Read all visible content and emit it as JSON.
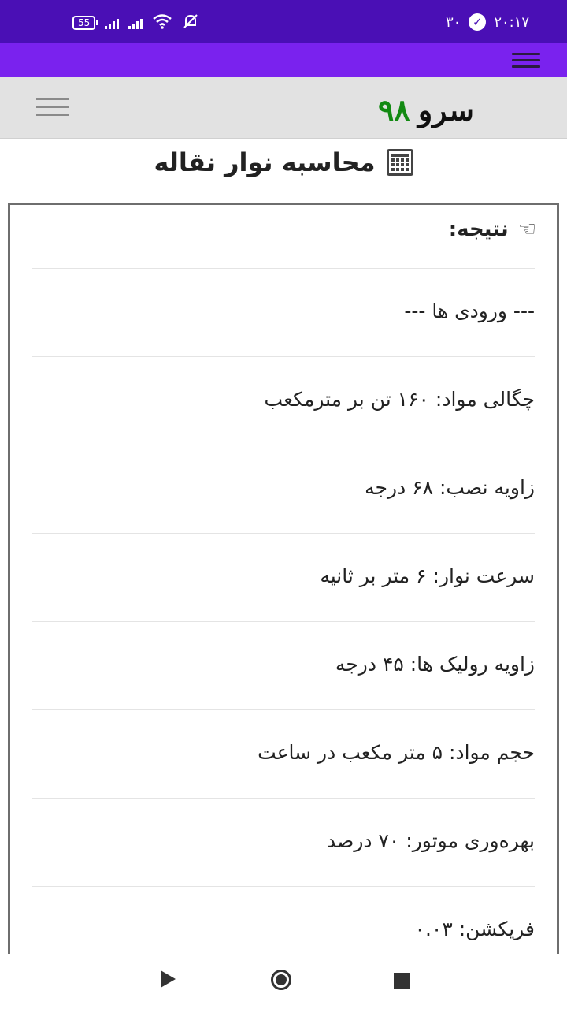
{
  "status_bar": {
    "time": "۲۰:۱۷",
    "notification_count": "۳۰",
    "battery": "55",
    "colors": {
      "background": "#4a0fb5"
    }
  },
  "app_bar": {
    "color": "#7a22ee",
    "menu_icon": "hamburger-icon"
  },
  "site_header": {
    "logo_word": "سرو",
    "logo_number": "۹۸",
    "menu_icon": "hamburger-icon"
  },
  "page": {
    "title": "محاسبه نوار نقاله",
    "title_icon": "calculator-icon"
  },
  "result": {
    "title": "نتیجه:",
    "title_icon": "hand-pointing-icon",
    "rows": [
      "--- ورودی ها ---",
      "چگالی مواد: ۱۶۰ تن بر مترمکعب",
      "زاویه نصب: ۶۸ درجه",
      "سرعت نوار: ۶ متر بر ثانیه",
      "زاویه رولیک ها: ۴۵ درجه",
      "حجم مواد: ۵ متر مکعب در ساعت",
      "بهره‌وری موتور: ۷۰ درصد",
      "فریکشن: ۰.۰۳"
    ]
  },
  "nav_bar": {
    "back_icon": "back-triangle-icon",
    "home_icon": "home-circle-icon",
    "recents_icon": "recents-square-icon"
  }
}
